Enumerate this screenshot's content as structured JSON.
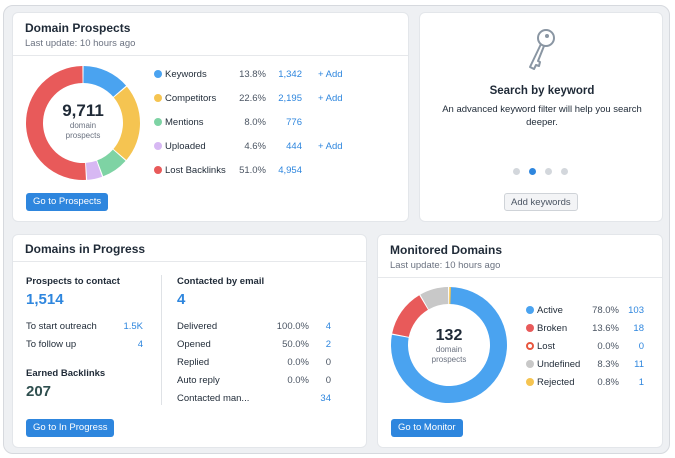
{
  "prospects": {
    "title": "Domain Prospects",
    "subtitle": "Last update: 10 hours ago",
    "total": "9,711",
    "total_label_1": "domain",
    "total_label_2": "prospects",
    "button": "Go to Prospects",
    "legend": [
      {
        "label": "Keywords",
        "pct": "13.8%",
        "value": "1,342",
        "add": "+ Add",
        "color": "#4aa3f0"
      },
      {
        "label": "Competitors",
        "pct": "22.6%",
        "value": "2,195",
        "add": "+ Add",
        "color": "#f5c451"
      },
      {
        "label": "Mentions",
        "pct": "8.0%",
        "value": "776",
        "add": "",
        "color": "#7ed3a4"
      },
      {
        "label": "Uploaded",
        "pct": "4.6%",
        "value": "444",
        "add": "+ Add",
        "color": "#d7b8f3"
      },
      {
        "label": "Lost Backlinks",
        "pct": "51.0%",
        "value": "4,954",
        "add": "",
        "color": "#e85a5a"
      }
    ]
  },
  "search": {
    "title": "Search by keyword",
    "desc_line1": "An advanced keyword filter will help you search",
    "desc_line2": "deeper.",
    "button": "Add keywords",
    "icon": "key-icon"
  },
  "progress": {
    "title": "Domains in Progress",
    "prospects_label": "Prospects to contact",
    "prospects_value": "1,514",
    "rows_left": [
      {
        "label": "To start outreach",
        "value": "1.5K"
      },
      {
        "label": "To follow up",
        "value": "4"
      }
    ],
    "earned_label": "Earned Backlinks",
    "earned_value": "207",
    "contacted_label": "Contacted by email",
    "contacted_value": "4",
    "rows_right": [
      {
        "label": "Delivered",
        "pct": "100.0%",
        "value": "4"
      },
      {
        "label": "Opened",
        "pct": "50.0%",
        "value": "2"
      },
      {
        "label": "Replied",
        "pct": "0.0%",
        "value": "0"
      },
      {
        "label": "Auto reply",
        "pct": "0.0%",
        "value": "0"
      },
      {
        "label": "Contacted man...",
        "pct": "",
        "value": "34"
      }
    ],
    "button": "Go to In Progress"
  },
  "monitored": {
    "title": "Monitored Domains",
    "subtitle": "Last update: 10 hours ago",
    "total": "132",
    "total_label_1": "domain",
    "total_label_2": "prospects",
    "button": "Go to Monitor",
    "legend": [
      {
        "label": "Active",
        "pct": "78.0%",
        "value": "103",
        "color": "#4aa3f0"
      },
      {
        "label": "Broken",
        "pct": "13.6%",
        "value": "18",
        "color": "#e85a5a"
      },
      {
        "label": "Lost",
        "pct": "0.0%",
        "value": "0",
        "color": "#e8573f"
      },
      {
        "label": "Undefined",
        "pct": "8.3%",
        "value": "11",
        "color": "#c8c8c8"
      },
      {
        "label": "Rejected",
        "pct": "0.8%",
        "value": "1",
        "color": "#f5c451"
      }
    ]
  }
}
